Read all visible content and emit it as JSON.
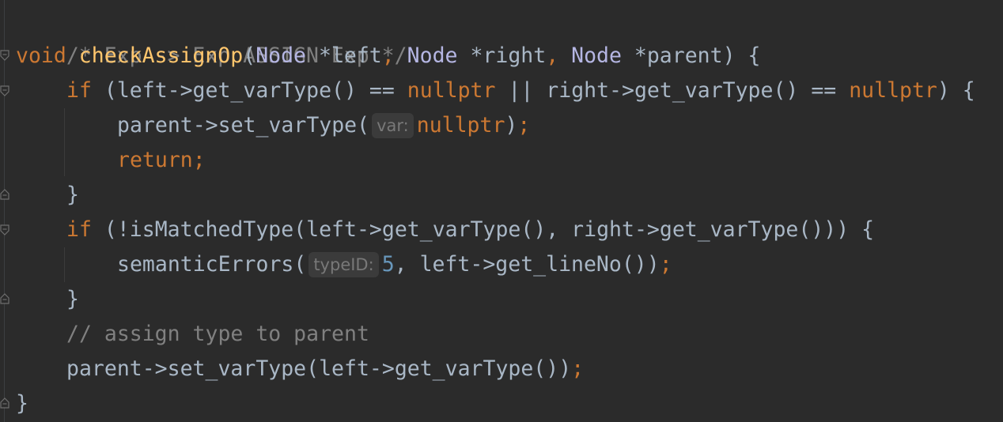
{
  "code": {
    "l1_comment": "/* Exp -> Exp ASSIGN Exp */",
    "l2_void": "void",
    "l2_fn": "checkAssignOp",
    "l2_open": "(",
    "l2_node1": "Node",
    "l2_left": " *left",
    "l2_comma1": ", ",
    "l2_node2": "Node",
    "l2_right": " *right",
    "l2_comma2": ", ",
    "l2_node3": "Node",
    "l2_parent": " *parent) {",
    "l3_if": "if",
    "l3_a": " (left->get_varType() == ",
    "l3_null1": "nullptr",
    "l3_b": " || right->get_varType() == ",
    "l3_null2": "nullptr",
    "l3_c": ") {",
    "l4_a": "parent->set_varType(",
    "l4_hint": "var:",
    "l4_null": "nullptr",
    "l4_b": ")",
    "l4_semi": ";",
    "l5_return": "return;",
    "l6_brace": "}",
    "l7_if": "if",
    "l7_a": " (!isMatchedType(left->get_varType(), right->get_varType())) {",
    "l8_a": "semanticErrors(",
    "l8_hint": "typeID:",
    "l8_num": "5",
    "l8_b": ", left->get_lineNo())",
    "l8_semi": ";",
    "l9_brace": "}",
    "l10_comment": "// assign type to parent",
    "l11_a": "parent->set_varType(left->get_varType())",
    "l11_semi": ";",
    "l12_brace": "}"
  },
  "colors": {
    "background": "#2b2b2b",
    "default_text": "#a9b7c6",
    "keyword": "#cc7832",
    "function_decl": "#ffc66d",
    "comment": "#808080",
    "number": "#6897bb",
    "type": "#b5b6e3",
    "inlay_hint_bg": "#3b3b3b",
    "inlay_hint_text": "#787878"
  },
  "icons": [
    "fold-open-icon",
    "fold-close-icon"
  ]
}
